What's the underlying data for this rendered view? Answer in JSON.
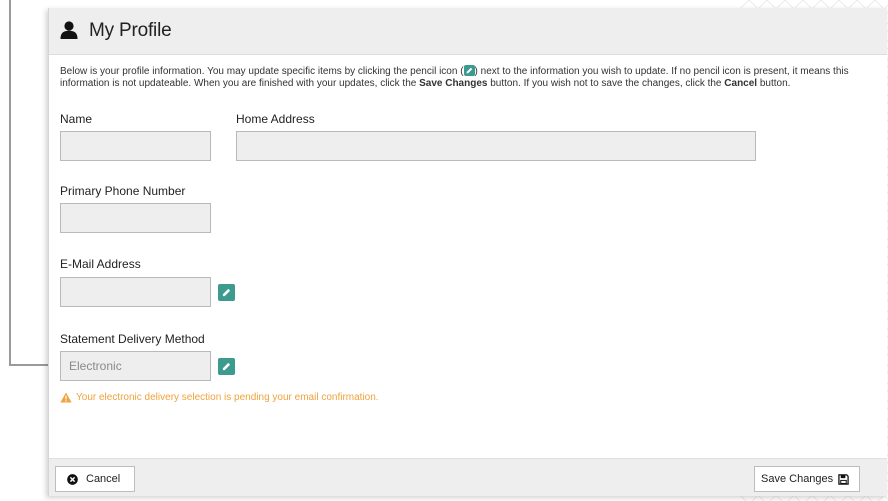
{
  "header": {
    "title": "My Profile",
    "icon": "user-icon"
  },
  "intro": {
    "part1": "Below is your profile information. You may update specific items by clicking the pencil icon (",
    "part2": ") next to the information you wish to update. If no pencil icon is present, it means this information is not updateable. When you are finished with your updates, click the ",
    "save_label": "Save Changes",
    "part3": " button. If you wish not to save the changes, click the ",
    "cancel_label": "Cancel",
    "part4": " button."
  },
  "fields": {
    "name": {
      "label": "Name",
      "value": ""
    },
    "home_address": {
      "label": "Home Address",
      "value": ""
    },
    "primary_phone": {
      "label": "Primary Phone Number",
      "value": ""
    },
    "email": {
      "label": "E-Mail Address",
      "value": ""
    },
    "statement_delivery": {
      "label": "Statement Delivery Method",
      "value": "Electronic"
    }
  },
  "warning": {
    "text": "Your electronic delivery selection is pending your email confirmation."
  },
  "footer": {
    "cancel_button": "Cancel",
    "save_button": "Save Changes"
  },
  "colors": {
    "accent": "#3d9a8f",
    "warning": "#f0a23c",
    "header_bg": "#eeeeee",
    "input_bg": "#eeeeee"
  }
}
